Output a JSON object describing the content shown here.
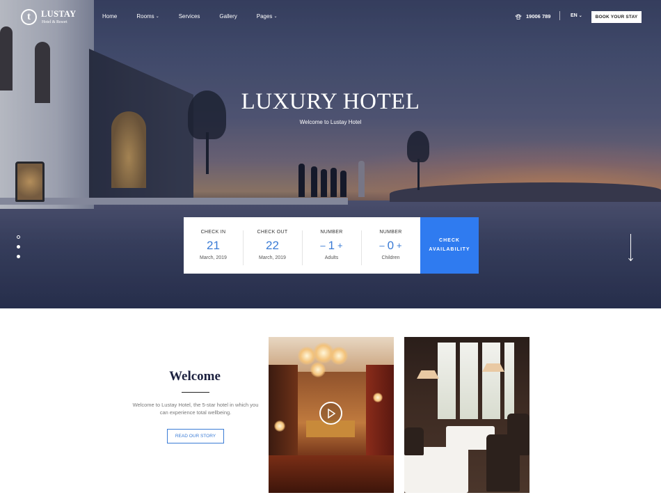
{
  "header": {
    "logo_mark": "t",
    "logo_name": "LUSTAY",
    "logo_sub": "Hotel & Resort",
    "nav": [
      {
        "label": "Home",
        "dropdown": false
      },
      {
        "label": "Rooms",
        "dropdown": true
      },
      {
        "label": "Services",
        "dropdown": false
      },
      {
        "label": "Gallery",
        "dropdown": false
      },
      {
        "label": "Pages",
        "dropdown": true
      }
    ],
    "phone": "19006 789",
    "language": "EN",
    "book_button": "BOOK YOUR STAY"
  },
  "hero": {
    "title": "LUXURY HOTEL",
    "subtitle": "Welcome to Lustay Hotel",
    "slides": {
      "active_label": "0"
    }
  },
  "booking": {
    "check_in": {
      "label": "CHECK IN",
      "value": "21",
      "sub": "March, 2019"
    },
    "check_out": {
      "label": "CHECK OUT",
      "value": "22",
      "sub": "March, 2019"
    },
    "adults": {
      "label": "NUMBER",
      "value": "1",
      "minus": "–",
      "plus": "+",
      "sub": "Adults"
    },
    "children": {
      "label": "NUMBER",
      "value": "0",
      "minus": "–",
      "plus": "+",
      "sub": "Children"
    },
    "button_line1": "CHECK",
    "button_line2": "AVAILABILITY"
  },
  "welcome": {
    "title": "Welcome",
    "text": "Welcome to Lustay Hotel, the 5-star hotel in which you can experience total wellbeing.",
    "button": "READ OUR STORY"
  },
  "colors": {
    "accent": "#2f7bf0",
    "text_accent": "#3a7bd5",
    "heading": "#1d2240"
  }
}
